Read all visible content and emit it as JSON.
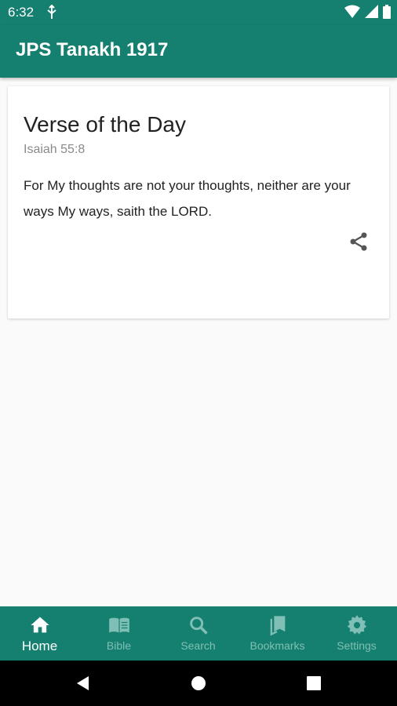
{
  "status_bar": {
    "time": "6:32"
  },
  "app_bar": {
    "title": "JPS Tanakh 1917"
  },
  "verse_card": {
    "title": "Verse of the Day",
    "reference": "Isaiah 55:8",
    "text": "For My thoughts are not your thoughts, neither are your ways My ways, saith the LORD.",
    "share_icon": "share-icon"
  },
  "bottom_nav": {
    "items": [
      {
        "label": "Home",
        "icon": "home-icon",
        "active": true
      },
      {
        "label": "Bible",
        "icon": "book-icon",
        "active": false
      },
      {
        "label": "Search",
        "icon": "search-icon",
        "active": false
      },
      {
        "label": "Bookmarks",
        "icon": "bookmark-icon",
        "active": false
      },
      {
        "label": "Settings",
        "icon": "gear-icon",
        "active": false
      }
    ]
  },
  "colors": {
    "primary": "#168070",
    "inactive_nav": "#7fbfb5",
    "background": "#fafafa"
  }
}
